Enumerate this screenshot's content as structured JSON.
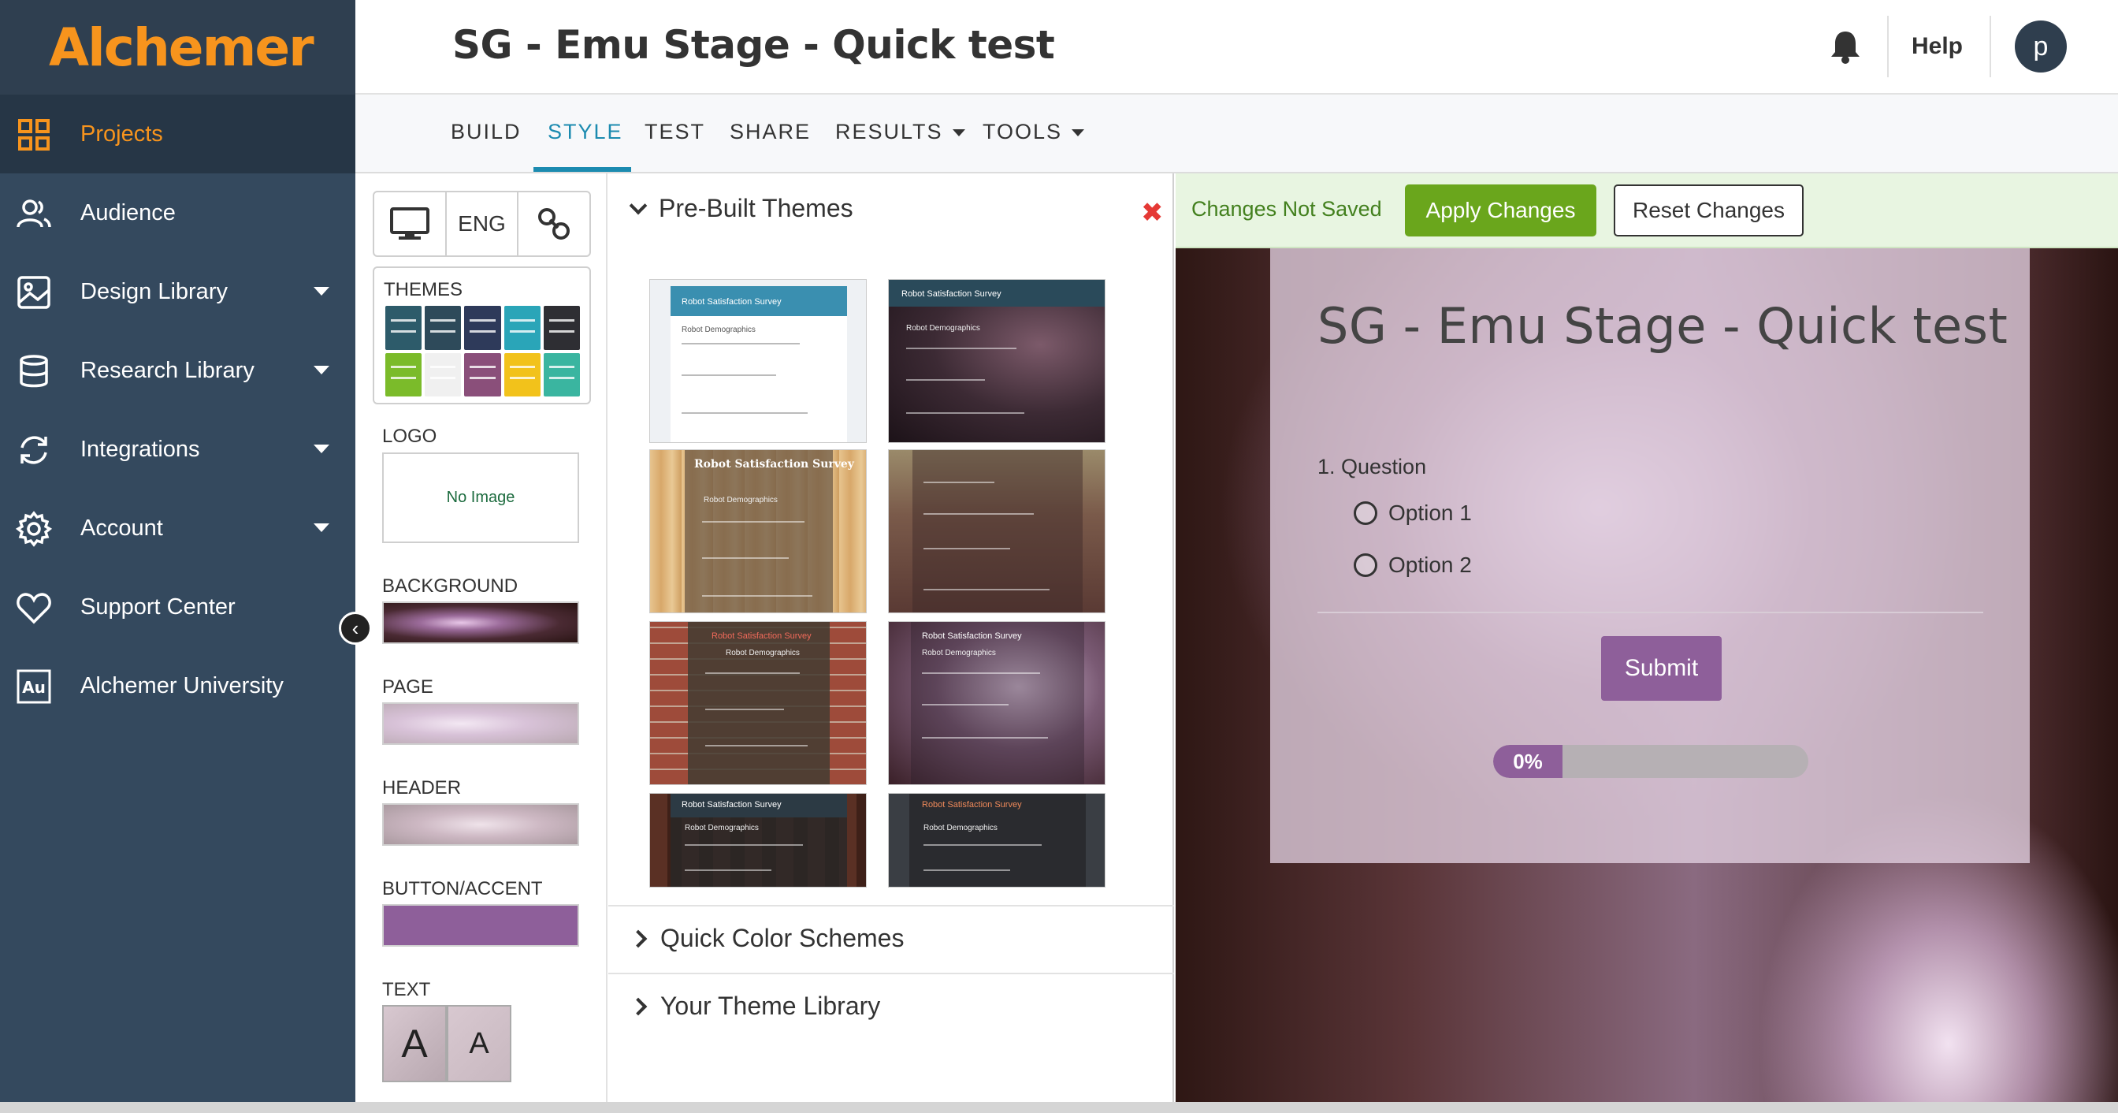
{
  "app": {
    "brand": "Alchemer",
    "title": "SG - Emu Stage - Quick test"
  },
  "sidebar": {
    "items": [
      {
        "label": "Projects",
        "icon": "grid-icon",
        "active": true,
        "dropdown": false
      },
      {
        "label": "Audience",
        "icon": "users-icon",
        "active": false,
        "dropdown": false
      },
      {
        "label": "Design Library",
        "icon": "image-icon",
        "active": false,
        "dropdown": true
      },
      {
        "label": "Research Library",
        "icon": "database-icon",
        "active": false,
        "dropdown": true
      },
      {
        "label": "Integrations",
        "icon": "sync-icon",
        "active": false,
        "dropdown": true
      },
      {
        "label": "Account",
        "icon": "gear-icon",
        "active": false,
        "dropdown": true
      },
      {
        "label": "Support Center",
        "icon": "heart-icon",
        "active": false,
        "dropdown": false
      },
      {
        "label": "Alchemer University",
        "icon": "au-icon",
        "active": false,
        "dropdown": false
      }
    ]
  },
  "header": {
    "help": "Help",
    "avatar_initial": "p"
  },
  "tabs": [
    {
      "label": "BUILD"
    },
    {
      "label": "STYLE",
      "active": true
    },
    {
      "label": "TEST"
    },
    {
      "label": "SHARE"
    },
    {
      "label": "RESULTS",
      "dropdown": true
    },
    {
      "label": "TOOLS",
      "dropdown": true
    }
  ],
  "style_panel": {
    "language": "ENG",
    "themes_label": "THEMES",
    "logo_label": "LOGO",
    "logo_placeholder": "No Image",
    "background_label": "BACKGROUND",
    "page_label": "PAGE",
    "header_label": "HEADER",
    "accent_label": "BUTTON/ACCENT",
    "text_label": "TEXT",
    "text_sample_1": "A",
    "text_sample_2": "A",
    "accent_color": "#8e5f9a",
    "theme_swatches": [
      "#2d5b6a",
      "#2e4a5a",
      "#2e3a5a",
      "#2aa5b8",
      "#2e2e33",
      "#7bbb2a",
      "#f0f0f0",
      "#8a4f7a",
      "#f2c21b",
      "#3ab5a0"
    ]
  },
  "themes_panel": {
    "prebuilt": "Pre-Built Themes",
    "quick": "Quick Color Schemes",
    "library": "Your Theme Library",
    "thumbnails": [
      {
        "title": "Robot Satisfaction Survey",
        "sub": "Robot Demographics"
      },
      {
        "title": "Robot Satisfaction Survey",
        "sub": "Robot Demographics"
      },
      {
        "title": "Robot Satisfaction Survey",
        "sub": "Robot Demographics"
      },
      {
        "title": "",
        "sub": ""
      },
      {
        "title": "Robot Satisfaction Survey",
        "sub": "Robot Demographics"
      },
      {
        "title": "Robot Satisfaction Survey",
        "sub": "Robot Demographics"
      },
      {
        "title": "Robot Satisfaction Survey",
        "sub": "Robot Demographics"
      },
      {
        "title": "Robot Satisfaction Survey",
        "sub": "Robot Demographics"
      }
    ]
  },
  "save_bar": {
    "status": "Changes Not Saved",
    "apply": "Apply Changes",
    "reset": "Reset Changes"
  },
  "preview": {
    "title": "SG - Emu Stage - Quick test",
    "question": "1. Question",
    "options": [
      "Option 1",
      "Option 2"
    ],
    "submit": "Submit",
    "progress_value": 0,
    "progress_label": "0%"
  }
}
